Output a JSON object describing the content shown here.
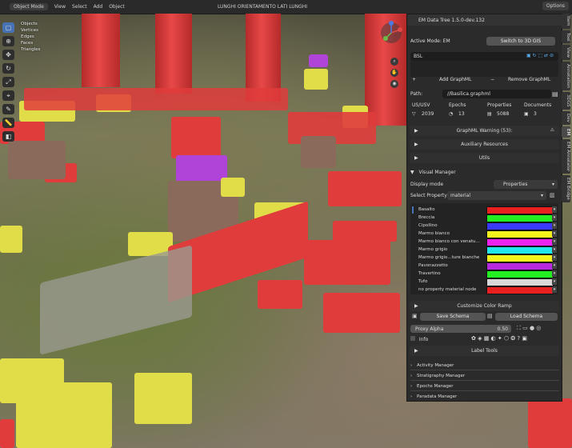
{
  "topbar": {
    "mode": "Object Mode",
    "menu": [
      "View",
      "Select",
      "Add",
      "Object"
    ],
    "scene_title": "LUNGHI ORIENTAMENTO LATI LUNGHI",
    "options": "Options"
  },
  "stats": [
    "Objects",
    "Vertices",
    "Edges",
    "Faces",
    "Triangles"
  ],
  "panel": {
    "header": "EM Data Tree 1.5.0-dev.132",
    "active_mode_label": "Active Mode: EM",
    "switch_button": "Switch to 3D GIS",
    "graph_name": "BSL",
    "add_graphml": "Add GraphML",
    "remove_graphml": "Remove GraphML",
    "path_label": "Path:",
    "path_value": "//Basilica.graphml",
    "counts": {
      "us_label": "US/USV",
      "us_value": "2039",
      "epochs_label": "Epochs",
      "epochs_value": "13",
      "properties_label": "Properties",
      "properties_value": "5088",
      "documents_label": "Documents",
      "documents_value": "3"
    },
    "graphml_warning": "GraphML Warning (53):",
    "aux_resources": "Auxiliary Resources",
    "utils": "Utils",
    "visual_manager": "Visual Manager",
    "display_mode_label": "Display mode",
    "display_mode_value": "Properties",
    "select_property_label": "Select Property:",
    "select_property_value": "material",
    "materials": [
      {
        "name": "Basalto",
        "color": "#e82020"
      },
      {
        "name": "Breccia",
        "color": "#22ee22"
      },
      {
        "name": "Cipollino",
        "color": "#3a3aff"
      },
      {
        "name": "Marmo bianco",
        "color": "#f4f41c"
      },
      {
        "name": "Marmo bianco con venatu...",
        "color": "#ee22ee"
      },
      {
        "name": "Marmo grigio",
        "color": "#22e6ee"
      },
      {
        "name": "Marmo grigio...ture bianche",
        "color": "#f4f41c"
      },
      {
        "name": "Pavonazzetto",
        "color": "#b82ae0"
      },
      {
        "name": "Travertino",
        "color": "#22ee22"
      },
      {
        "name": "Tufo",
        "color": "#d8d8d8"
      },
      {
        "name": "no property material node",
        "color": "#e82020"
      }
    ],
    "customize_color_ramp": "Customize Color Ramp",
    "save_schema": "Save Schema",
    "load_schema": "Load Schema",
    "proxy_alpha_label": "Proxy Alpha",
    "proxy_alpha_value": "0.50",
    "info_label": "Info",
    "label_tools": "Label Tools",
    "managers": [
      "Activity Manager",
      "Stratigraphy Manager",
      "Epochs Manager",
      "Paradata Manager"
    ]
  },
  "side_tabs": [
    "Item",
    "Tool",
    "View",
    "Annotation",
    "3DGS",
    "Dev",
    "EM",
    "EM Annotator",
    "EM Bridge"
  ]
}
